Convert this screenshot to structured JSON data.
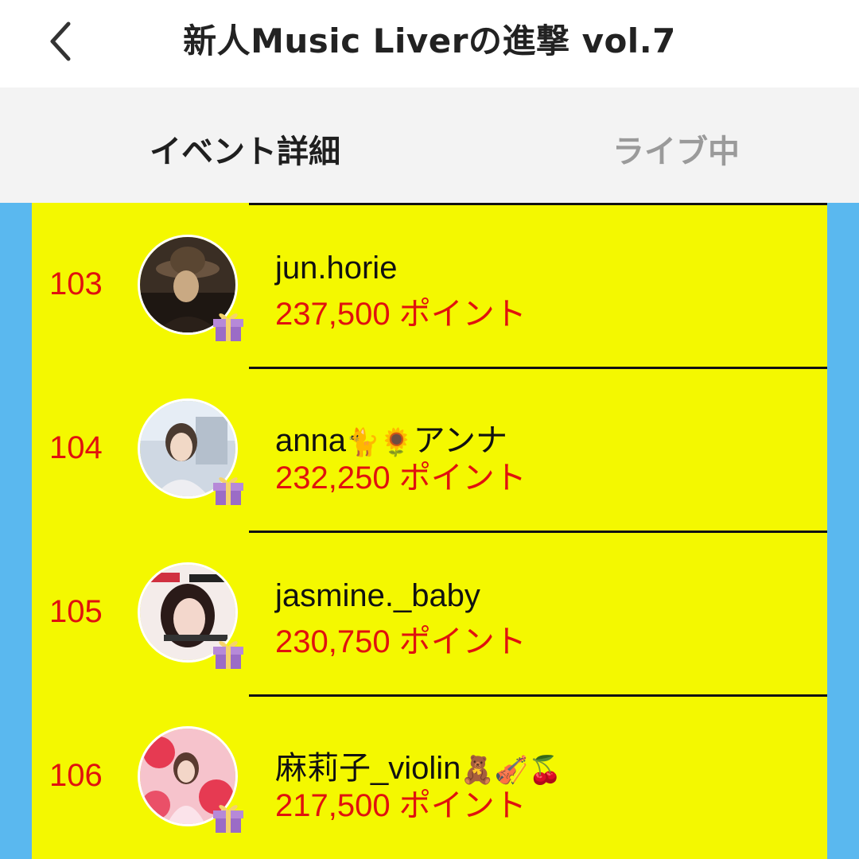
{
  "header": {
    "title": "新人Music Liverの進撃 vol.7"
  },
  "tabs": {
    "details": "イベント詳細",
    "live": "ライブ中"
  },
  "rankings": [
    {
      "rank": "103",
      "name": "jun.horie",
      "emoji": "",
      "points": "237,500 ポイント"
    },
    {
      "rank": "104",
      "name": "anna",
      "emoji": "🐈🌻",
      "suffix": "アンナ",
      "points": "232,250 ポイント"
    },
    {
      "rank": "105",
      "name": "jasmine._baby",
      "emoji": "",
      "points": "230,750 ポイント"
    },
    {
      "rank": "106",
      "name": "麻莉子_violin",
      "emoji": "🧸🎻🍒",
      "points": "217,500 ポイント"
    }
  ],
  "colors": {
    "panel": "#f4f800",
    "sidebar": "#5ab8ef",
    "rank": "#e0120e",
    "points": "#e0120e"
  },
  "icons": [
    "back-chevron-icon",
    "gift-icon"
  ]
}
